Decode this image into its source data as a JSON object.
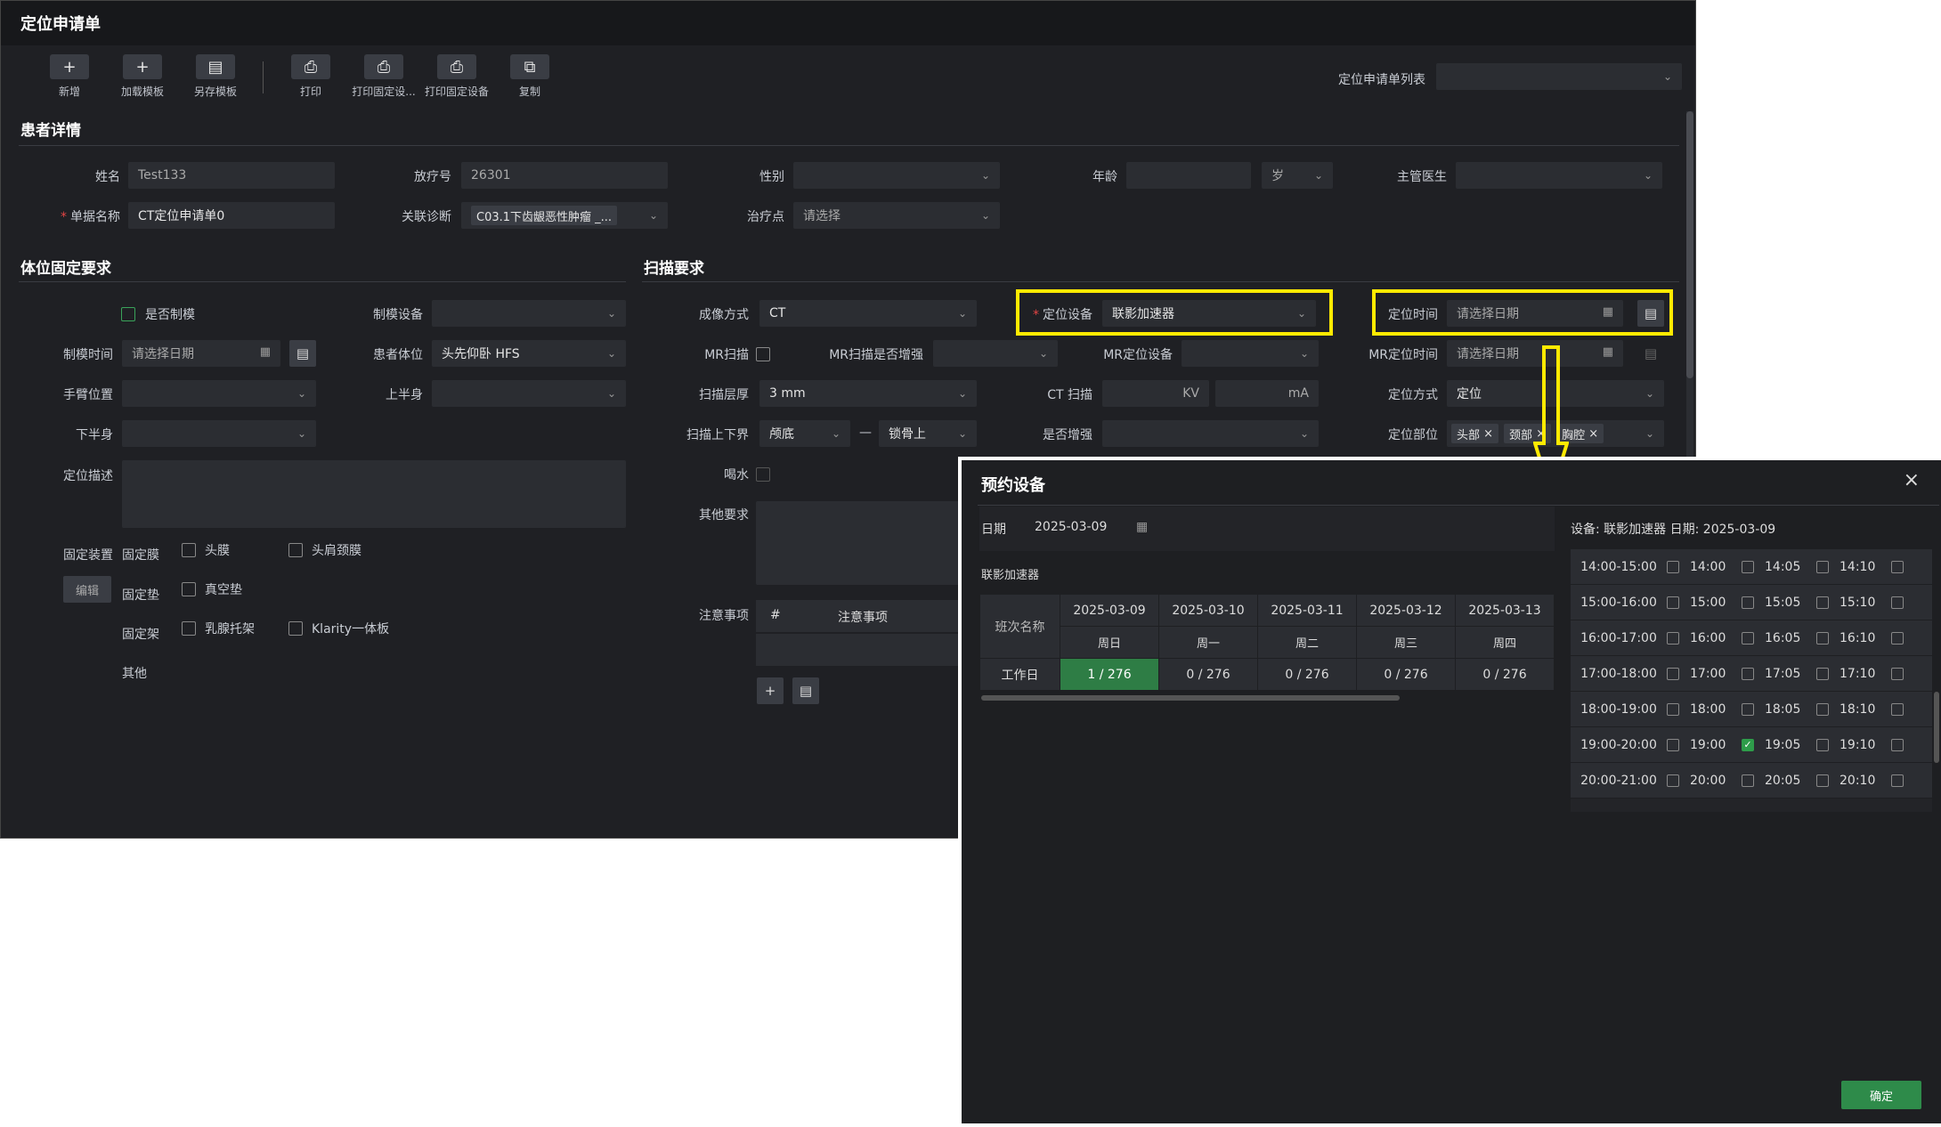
{
  "title": "定位申请单",
  "toolbar": [
    {
      "label": "新增",
      "icon": "plus-icon"
    },
    {
      "label": "加载模板",
      "icon": "plus-icon"
    },
    {
      "label": "另存模板",
      "icon": "save-icon"
    },
    {
      "label": "打印",
      "icon": "print-icon"
    },
    {
      "label": "打印固定设...",
      "icon": "print-icon"
    },
    {
      "label": "打印固定设备",
      "icon": "print-icon"
    },
    {
      "label": "复制",
      "icon": "copy-icon"
    }
  ],
  "list_label": "定位申请单列表",
  "patient": {
    "section": "患者详情",
    "name_label": "姓名",
    "name": "Test133",
    "rtno_label": "放疗号",
    "rtno": "26301",
    "gender_label": "性别",
    "age_label": "年龄",
    "age_unit": "岁",
    "doctor_label": "主管医生",
    "docname_label": "单据名称",
    "docname": "CT定位申请单0",
    "diag_label": "关联诊断",
    "diag": "C03.1下齿龈恶性肿瘤 _...",
    "treat_label": "治疗点",
    "treat_placeholder": "请选择"
  },
  "fix": {
    "section": "体位固定要求",
    "mold_label": "是否制模",
    "molddev_label": "制模设备",
    "moldtime_label": "制模时间",
    "date_placeholder": "请选择日期",
    "posture_label": "患者体位",
    "posture": "头先仰卧 HFS",
    "arm_label": "手臂位置",
    "upper_label": "上半身",
    "lower_label": "下半身",
    "desc_label": "定位描述",
    "device_label": "固定装置",
    "edit_label": "编辑",
    "membrane_label": "固定膜",
    "m1": "头膜",
    "m2": "头肩颈膜",
    "pad_label": "固定垫",
    "p1": "真空垫",
    "rack_label": "固定架",
    "r1": "乳腺托架",
    "r2": "Klarity一体板",
    "other_label": "其他"
  },
  "scan": {
    "section": "扫描要求",
    "mode_label": "成像方式",
    "mode": "CT",
    "locdev_label": "定位设备",
    "locdev": "联影加速器",
    "loctime_label": "定位时间",
    "date_placeholder": "请选择日期",
    "mr_label": "MR扫描",
    "mrenh_label": "MR扫描是否增强",
    "mrdev_label": "MR定位设备",
    "mrtime_label": "MR定位时间",
    "layer_label": "扫描层厚",
    "layer": "3 mm",
    "ct_label": "CT 扫描",
    "kv": "KV",
    "ma": "mA",
    "locmode_label": "定位方式",
    "locmode": "定位",
    "range_label": "扫描上下界",
    "range_top": "颅底",
    "range_sep": "—",
    "range_bottom": "锁骨上",
    "enh_label": "是否增强",
    "parts_label": "定位部位",
    "parts": [
      "头部",
      "颈部",
      "胸腔"
    ],
    "water_label": "喝水",
    "other_label": "其他要求",
    "note_label": "注意事项",
    "note_hash": "#",
    "note_col": "注意事项"
  },
  "dialog": {
    "title": "预约设备",
    "date_label": "日期",
    "date": "2025-03-09",
    "device": "联影加速器",
    "right_header": "设备: 联影加速器  日期: 2025-03-09",
    "shift_col": "班次名称",
    "days": [
      {
        "date": "2025-03-09",
        "week": "周日",
        "val": "1 / 276"
      },
      {
        "date": "2025-03-10",
        "week": "周一",
        "val": "0 / 276"
      },
      {
        "date": "2025-03-11",
        "week": "周二",
        "val": "0 / 276"
      },
      {
        "date": "2025-03-12",
        "week": "周三",
        "val": "0 / 276"
      },
      {
        "date": "2025-03-13",
        "week": "周四",
        "val": "0 / 276"
      }
    ],
    "shift": "工作日",
    "slots": [
      {
        "range": "14:00-15:00",
        "t": [
          "14:00",
          "14:05",
          "14:10"
        ],
        "checked": [
          false,
          false,
          false
        ]
      },
      {
        "range": "15:00-16:00",
        "t": [
          "15:00",
          "15:05",
          "15:10"
        ],
        "checked": [
          false,
          false,
          false
        ]
      },
      {
        "range": "16:00-17:00",
        "t": [
          "16:00",
          "16:05",
          "16:10"
        ],
        "checked": [
          false,
          false,
          false
        ]
      },
      {
        "range": "17:00-18:00",
        "t": [
          "17:00",
          "17:05",
          "17:10"
        ],
        "checked": [
          false,
          false,
          false
        ]
      },
      {
        "range": "18:00-19:00",
        "t": [
          "18:00",
          "18:05",
          "18:10"
        ],
        "checked": [
          false,
          false,
          false
        ]
      },
      {
        "range": "19:00-20:00",
        "t": [
          "19:00",
          "19:05",
          "19:10"
        ],
        "checked": [
          false,
          true,
          false
        ]
      },
      {
        "range": "20:00-21:00",
        "t": [
          "20:00",
          "20:05",
          "20:10"
        ],
        "checked": [
          false,
          false,
          false
        ]
      }
    ],
    "ok": "确定"
  }
}
